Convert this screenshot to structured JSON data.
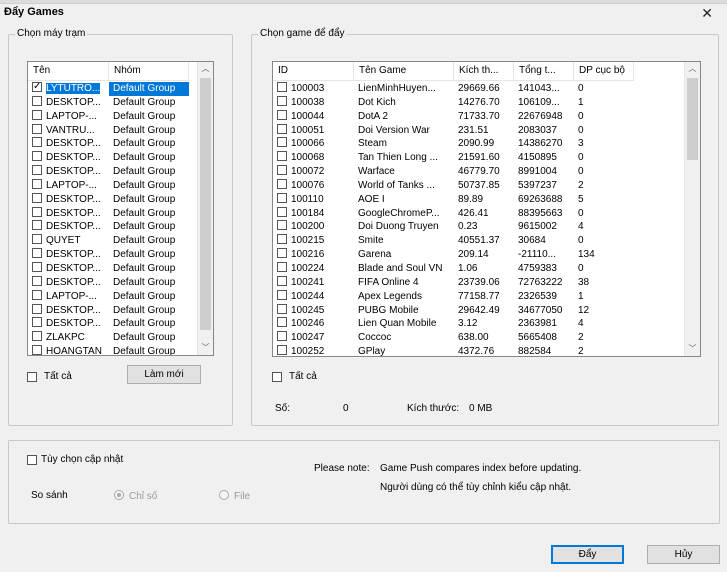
{
  "window": {
    "title": "Đẩy Games",
    "close_glyph": "✕"
  },
  "stations": {
    "group_title": "Chọn máy trạm",
    "columns": [
      "Tên",
      "Nhóm"
    ],
    "rows": [
      {
        "name": "LYTUTRO...",
        "group": "Default Group",
        "checked": true,
        "selected": true
      },
      {
        "name": "DESKTOP...",
        "group": "Default Group",
        "checked": false
      },
      {
        "name": "LAPTOP-...",
        "group": "Default Group",
        "checked": false
      },
      {
        "name": "VANTRU...",
        "group": "Default Group",
        "checked": false
      },
      {
        "name": "DESKTOP...",
        "group": "Default Group",
        "checked": false
      },
      {
        "name": "DESKTOP...",
        "group": "Default Group",
        "checked": false
      },
      {
        "name": "DESKTOP...",
        "group": "Default Group",
        "checked": false
      },
      {
        "name": "LAPTOP-...",
        "group": "Default Group",
        "checked": false
      },
      {
        "name": "DESKTOP...",
        "group": "Default Group",
        "checked": false
      },
      {
        "name": "DESKTOP...",
        "group": "Default Group",
        "checked": false
      },
      {
        "name": "DESKTOP...",
        "group": "Default Group",
        "checked": false
      },
      {
        "name": "QUYET",
        "group": "Default Group",
        "checked": false
      },
      {
        "name": "DESKTOP...",
        "group": "Default Group",
        "checked": false
      },
      {
        "name": "DESKTOP...",
        "group": "Default Group",
        "checked": false
      },
      {
        "name": "DESKTOP...",
        "group": "Default Group",
        "checked": false
      },
      {
        "name": "LAPTOP-...",
        "group": "Default Group",
        "checked": false
      },
      {
        "name": "DESKTOP...",
        "group": "Default Group",
        "checked": false
      },
      {
        "name": "DESKTOP...",
        "group": "Default Group",
        "checked": false
      },
      {
        "name": "ZLAKPC",
        "group": "Default Group",
        "checked": false
      },
      {
        "name": "HOANGTAN",
        "group": "Default Group",
        "checked": false
      }
    ],
    "select_all_label": "Tất cả",
    "refresh_label": "Làm mới"
  },
  "games": {
    "group_title": "Chọn game để đẩy",
    "columns": [
      "ID",
      "Tên Game",
      "Kích th...",
      "Tổng t...",
      "DP cục bộ"
    ],
    "rows": [
      [
        "100003",
        "LienMinhHuyen...",
        "29669.66",
        "141043...",
        "0"
      ],
      [
        "100038",
        "Dot Kich",
        "14276.70",
        "106109...",
        "1"
      ],
      [
        "100044",
        "DotA 2",
        "71733.70",
        "22676948",
        "0"
      ],
      [
        "100051",
        "Doi Version War",
        "231.51",
        "2083037",
        "0"
      ],
      [
        "100066",
        "Steam",
        "2090.99",
        "14386270",
        "3"
      ],
      [
        "100068",
        "Tan Thien Long ...",
        "21591.60",
        "4150895",
        "0"
      ],
      [
        "100072",
        "Warface",
        "46779.70",
        "8991004",
        "0"
      ],
      [
        "100076",
        "World of Tanks ...",
        "50737.85",
        "5397237",
        "2"
      ],
      [
        "100110",
        "AOE I",
        "89.89",
        "69263688",
        "5"
      ],
      [
        "100184",
        "GoogleChromeP...",
        "426.41",
        "88395663",
        "0"
      ],
      [
        "100200",
        "Doi Duong Truyen",
        "0.23",
        "9615002",
        "4"
      ],
      [
        "100215",
        "Smite",
        "40551.37",
        "30684",
        "0"
      ],
      [
        "100216",
        "Garena",
        "209.14",
        "-21110...",
        "134"
      ],
      [
        "100224",
        "Blade and Soul VN",
        "1.06",
        "4759383",
        "0"
      ],
      [
        "100241",
        "FIFA Online 4",
        "23739.06",
        "72763222",
        "38"
      ],
      [
        "100244",
        "Apex Legends",
        "77158.77",
        "2326539",
        "1"
      ],
      [
        "100245",
        "PUBG Mobile",
        "29642.49",
        "34677050",
        "12"
      ],
      [
        "100246",
        "Lien Quan Mobile",
        "3.12",
        "2363981",
        "4"
      ],
      [
        "100247",
        "Coccoc",
        "638.00",
        "5665408",
        "2"
      ],
      [
        "100252",
        "GPlay",
        "4372.76",
        "882584",
        "2"
      ]
    ],
    "select_all_label": "Tất cả",
    "count_label": "Số:",
    "count_value": "0",
    "size_label": "Kích thước:",
    "size_value": "0 MB"
  },
  "update_options": {
    "checkbox_label": "Tùy chọn cập nhật",
    "compare_label": "So sánh",
    "radio_index": "Chỉ số",
    "radio_file": "File",
    "note_label": "Please note:",
    "note_line1": "Game Push compares index before updating.",
    "note_line2": "Người dùng có thể tùy chỉnh kiểu cập nhật."
  },
  "footer": {
    "ok_label": "Đẩy",
    "cancel_label": "Hủy"
  },
  "colors": {
    "selection": "#0078d7",
    "background": "#f0f0f0"
  }
}
